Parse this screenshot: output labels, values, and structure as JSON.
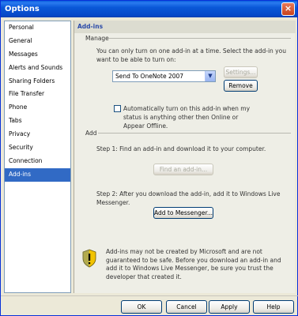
{
  "window": {
    "title": "Options",
    "close_glyph": "×"
  },
  "nav": {
    "items": [
      {
        "label": "Personal",
        "active": false
      },
      {
        "label": "General",
        "active": false
      },
      {
        "label": "Messages",
        "active": false
      },
      {
        "label": "Alerts and Sounds",
        "active": false
      },
      {
        "label": "Sharing Folders",
        "active": false
      },
      {
        "label": "File Transfer",
        "active": false
      },
      {
        "label": "Phone",
        "active": false
      },
      {
        "label": "Tabs",
        "active": false
      },
      {
        "label": "Privacy",
        "active": false
      },
      {
        "label": "Security",
        "active": false
      },
      {
        "label": "Connection",
        "active": false
      },
      {
        "label": "Add-ins",
        "active": true
      }
    ]
  },
  "panel": {
    "title": "Add-ins",
    "manage": {
      "label": "Manage",
      "description": "You can only turn on one add-in at a time. Select the add-in you want to be able to turn on:",
      "selected_addin": "Send To OneNote 2007",
      "settings_button": "Settings...",
      "remove_button": "Remove",
      "auto_checkbox_label": "Automatically turn on this add-in when my status is anything other then Online or Appear Offline.",
      "auto_checkbox_checked": false
    },
    "add": {
      "label": "Add",
      "step1": "Step 1: Find an add-in and download it to your computer.",
      "find_button": "Find an add-in...",
      "step2": "Step 2: After you download the add-in, add it to Windows Live Messenger.",
      "add_button": "Add to Messenger..."
    },
    "warning": {
      "icon": "shield-warning-icon",
      "text": "Add-ins may not be created by Microsoft and are not guaranteed to be safe. Before you download an add-in and add it to Windows Live Messenger, be sure you trust the developer that created it."
    }
  },
  "footer": {
    "ok": "OK",
    "cancel": "Cancel",
    "apply": "Apply",
    "help": "Help"
  },
  "colors": {
    "titlebar": "#0a58d8",
    "selection": "#316ac5",
    "panel_header_text": "#2a4aa8"
  }
}
